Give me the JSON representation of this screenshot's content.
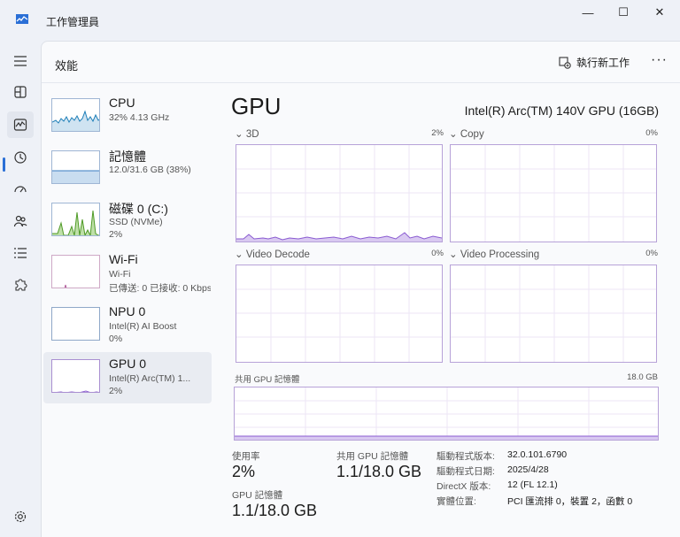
{
  "window": {
    "title": "工作管理員",
    "minimize": "—",
    "maximize": "☐",
    "close": "✕"
  },
  "header": {
    "title": "效能",
    "run_task_label": "執行新工作",
    "more": "···"
  },
  "devices": [
    {
      "name": "CPU",
      "line1": "32% 4.13 GHz",
      "line2": ""
    },
    {
      "name": "記憶體",
      "line1": "12.0/31.6 GB (38%)",
      "line2": ""
    },
    {
      "name": "磁碟 0 (C:)",
      "line1": "SSD (NVMe)",
      "line2": "2%"
    },
    {
      "name": "Wi-Fi",
      "line1": "Wi-Fi",
      "line2": "已傳送: 0 已接收: 0 Kbps"
    },
    {
      "name": "NPU 0",
      "line1": "Intel(R) AI Boost",
      "line2": "0%"
    },
    {
      "name": "GPU 0",
      "line1": "Intel(R) Arc(TM) 1...",
      "line2": "2%"
    }
  ],
  "gpu": {
    "title": "GPU",
    "model": "Intel(R) Arc(TM) 140V GPU (16GB)",
    "engines": [
      {
        "label": "3D",
        "percent": "2%"
      },
      {
        "label": "Copy",
        "percent": "0%"
      },
      {
        "label": "Video Decode",
        "percent": "0%"
      },
      {
        "label": "Video Processing",
        "percent": "0%"
      }
    ],
    "shared_memory": {
      "label": "共用 GPU 記憶體",
      "max": "18.0 GB"
    }
  },
  "stats": {
    "utilization_label": "使用率",
    "utilization_value": "2%",
    "shared_mem_label": "共用 GPU 記憶體",
    "shared_mem_value": "1.1/18.0 GB",
    "gpu_mem_label": "GPU 記憶體",
    "gpu_mem_value": "1.1/18.0 GB"
  },
  "info": [
    {
      "key": "驅動程式版本:",
      "value": "32.0.101.6790"
    },
    {
      "key": "驅動程式日期:",
      "value": "2025/4/28"
    },
    {
      "key": "DirectX 版本:",
      "value": "12 (FL 12.1)"
    },
    {
      "key": "實體位置:",
      "value": "PCI 匯流排 0，裝置 2，函數 0"
    }
  ],
  "colors": {
    "accent": "#2a6fd6",
    "gpu_line": "#8a5bd1",
    "gpu_fill": "#d9c9f1",
    "cpu_line": "#1e7fb8",
    "disk_line": "#4f9a26"
  }
}
